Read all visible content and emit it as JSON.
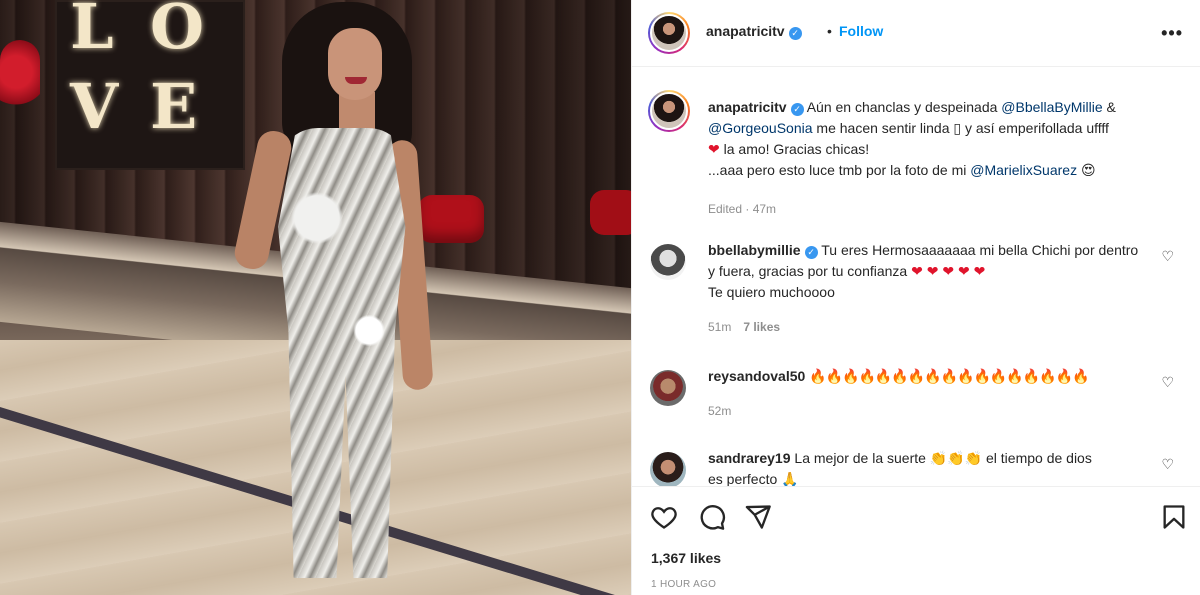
{
  "photo": {
    "sign_letters": [
      "L",
      "O",
      "V",
      "E"
    ]
  },
  "header": {
    "username": "anapatricitv",
    "dot": "•",
    "follow_label": "Follow",
    "more_label": "•••"
  },
  "caption": {
    "username": "anapatricitv",
    "text_1": " Aún en chanclas y despeinada ",
    "mention_1": "@BbellaByMillie",
    "text_2": " & ",
    "mention_2": "@GorgeouSonia",
    "text_3": " me hacen sentir linda ▯ y así emperifollada uffff",
    "text_4": "la amo! Gracias chicas!",
    "text_5": "...aaa pero esto luce tmb por la foto de mi ",
    "mention_3": "@MarielixSuarez",
    "emoji_heart": "❤",
    "emoji_eyes": "😍",
    "meta": "Edited · 47m"
  },
  "comments": [
    {
      "username": "bbellabymillie",
      "text": " Tu eres Hermosaaaaaaa mi bella Chichi por dentro y fuera, gracias por tu confianza ",
      "emoji": "❤ ❤ ❤ ❤ ❤",
      "text_2": "Te quiero muchoooo",
      "time": "51m",
      "likes": "7 likes"
    },
    {
      "username": "reysandoval50",
      "emoji": "🔥🔥🔥🔥🔥🔥🔥🔥🔥🔥🔥🔥🔥🔥🔥🔥🔥",
      "time": "52m"
    },
    {
      "username": "sandrarey19",
      "text": " La mejor de la suerte ",
      "emoji": "👏👏👏",
      "text_2": " el tiempo de dios",
      "text_3": "es perfecto 🙏"
    }
  ],
  "footer": {
    "likes": "1,367 likes",
    "time": "1 HOUR AGO"
  },
  "icons": {
    "like": "heart-icon",
    "comment": "comment-icon",
    "share": "share-icon",
    "save": "bookmark-icon"
  },
  "colors": {
    "link": "#0095f6",
    "mention": "#00376b",
    "verified": "#3897f0",
    "muted": "#8e8e8e"
  }
}
